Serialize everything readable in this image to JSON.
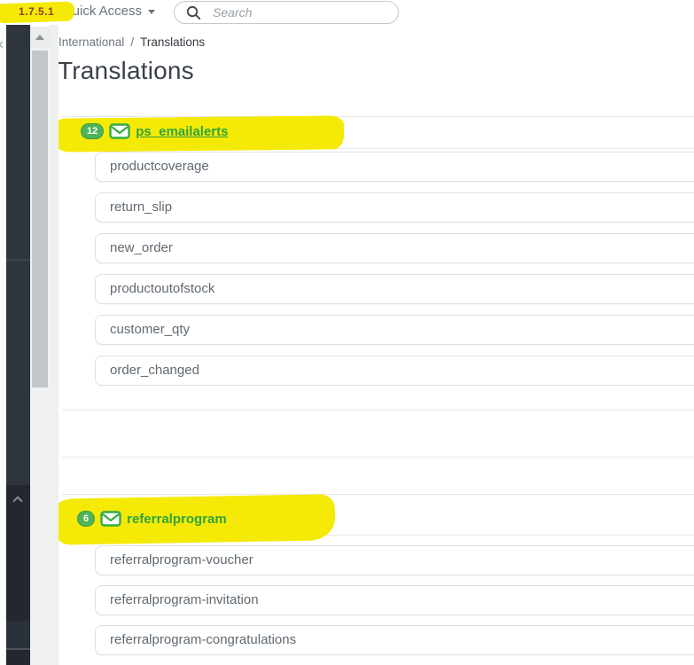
{
  "topbar": {
    "version": "1.7.5.1",
    "quick_access_label": "Quick Access",
    "search_placeholder": "Search"
  },
  "breadcrumb": {
    "parent": "International",
    "separator": "/",
    "current": "Translations"
  },
  "page_title": "Translations",
  "sections": [
    {
      "badge": "12",
      "name": "ps_emailalerts",
      "icon": "envelope-icon",
      "items": [
        "productcoverage",
        "return_slip",
        "new_order",
        "productoutofstock",
        "customer_qty",
        "order_changed"
      ]
    },
    {
      "badge": "6",
      "name": "referralprogram",
      "icon": "envelope-icon",
      "items": [
        "referralprogram-voucher",
        "referralprogram-invitation",
        "referralprogram-congratulations"
      ]
    }
  ],
  "colors": {
    "accent_green": "#2fa33c",
    "badge_green": "#4fb457",
    "highlight_yellow": "#f5ea05",
    "version_text": "#8a3f28",
    "sidebar_dark": "#2f353d"
  }
}
